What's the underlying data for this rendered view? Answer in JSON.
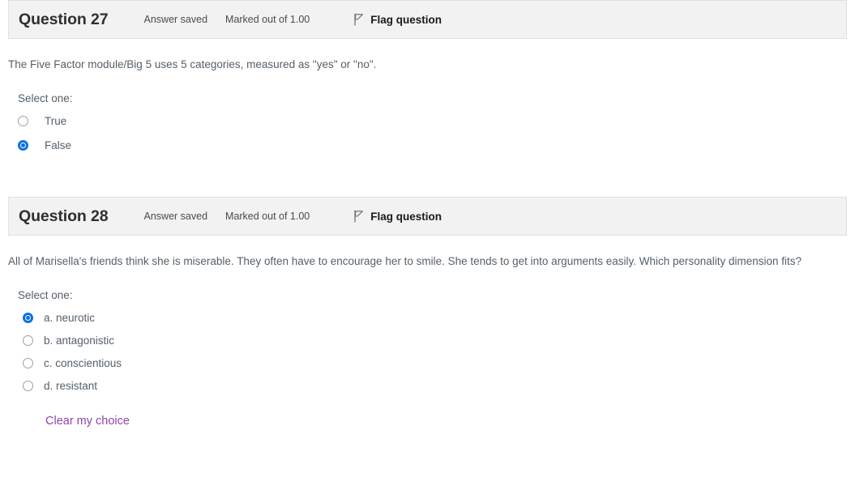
{
  "questions": [
    {
      "number_label": "Question 27",
      "state": "Answer saved",
      "grade": "Marked out of 1.00",
      "flag_label": "Flag question",
      "flag_icon": "flag-outline-icon",
      "text": "The Five Factor module/Big 5 uses 5 categories, measured as \"yes\" or \"no\".",
      "prompt": "Select one:",
      "type": "truefalse",
      "options": [
        {
          "label": "True",
          "selected": false
        },
        {
          "label": "False",
          "selected": true
        }
      ],
      "clear_label": null
    },
    {
      "number_label": "Question 28",
      "state": "Answer saved",
      "grade": "Marked out of 1.00",
      "flag_label": "Flag question",
      "flag_icon": "flag-outline-icon",
      "text": "All of Marisella's friends think she is miserable.  They often have to encourage her to smile. She tends to get into arguments easily. Which personality dimension fits?",
      "prompt": "Select one:",
      "type": "multichoice",
      "options": [
        {
          "label": "a. neurotic",
          "selected": true
        },
        {
          "label": "b. antagonistic",
          "selected": false
        },
        {
          "label": "c. conscientious",
          "selected": false
        },
        {
          "label": "d. resistant",
          "selected": false
        }
      ],
      "clear_label": "Clear my choice"
    }
  ],
  "colors": {
    "header_bg": "#f2f2f2",
    "header_border": "#e0e0e0",
    "radio_selected": "#0b72e0",
    "link_purple": "#8e44ad",
    "body_text": "#55606a",
    "title_text": "#2f2f2f"
  }
}
